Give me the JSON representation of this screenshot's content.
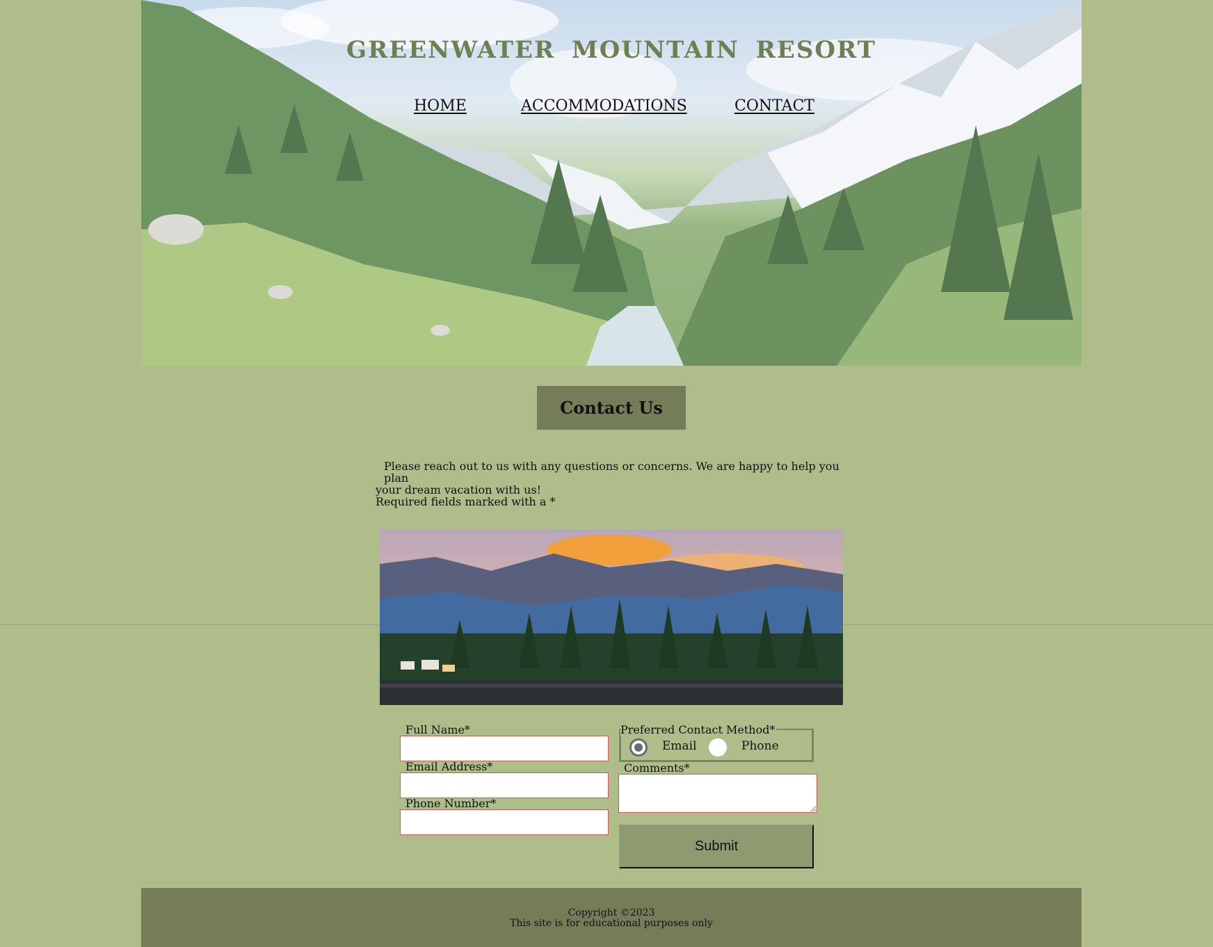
{
  "header": {
    "title": "GREENWATER MOUNTAIN RESORT",
    "nav": [
      {
        "label": "HOME"
      },
      {
        "label": "ACCOMMODATIONS"
      },
      {
        "label": "CONTACT"
      }
    ],
    "banner_image": "mountain-valley-forest-river"
  },
  "main": {
    "heading": "Contact Us",
    "intro_line1": "Please reach out to us with any questions or concerns. We are happy to help you plan",
    "intro_line2": "your dream vacation with us!",
    "intro_line3": "Required fields marked with a *",
    "photo": "mountain-lake-sunset"
  },
  "form": {
    "full_name_label": "Full Name*",
    "full_name_value": "",
    "email_label": "Email Address*",
    "email_value": "",
    "phone_label": "Phone Number*",
    "phone_value": "",
    "contact_method_legend": "Preferred Contact Method*",
    "options": [
      {
        "label": "Email",
        "checked": true
      },
      {
        "label": "Phone",
        "checked": false
      }
    ],
    "comments_label": "Comments*",
    "comments_value": "",
    "submit_label": "Submit"
  },
  "footer": {
    "copyright": "Copyright ©2023",
    "note": "This site is for educational purposes only"
  },
  "colors": {
    "page_bg": "#afbd8b",
    "heading_bg": "#747d58",
    "footer_bg": "#747d58",
    "submit_bg": "#8e9a70",
    "title_color": "#6f7f55",
    "field_border": "#c85a5a"
  }
}
